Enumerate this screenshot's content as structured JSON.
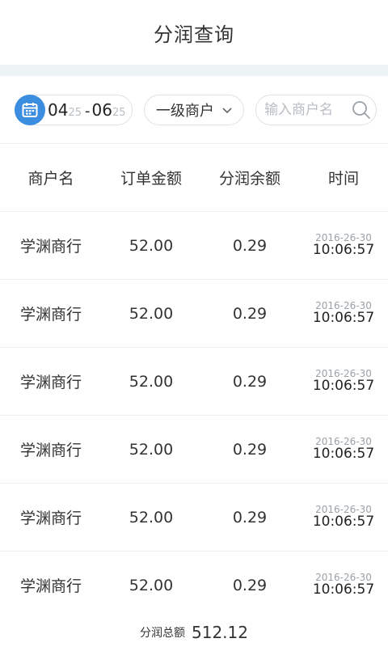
{
  "header": {
    "title": "分润查询"
  },
  "filters": {
    "date_range": {
      "start_month": "04",
      "start_day": "25",
      "separator": "-",
      "end_month": "06",
      "end_day": "25",
      "icon": "calendar-icon",
      "icon_color": "#3b8de0"
    },
    "merchant_level": {
      "selected": "一级商户",
      "icon": "chevron-down-icon"
    },
    "search": {
      "placeholder": "输入商户名",
      "value": "",
      "icon": "search-icon"
    }
  },
  "table": {
    "columns": [
      "商户名",
      "订单金额",
      "分润余额",
      "时间"
    ],
    "rows": [
      {
        "merchant": "学渊商行",
        "order_amount": "52.00",
        "profit_balance": "0.29",
        "date": "2016-26-30",
        "time": "10:06:57"
      },
      {
        "merchant": "学渊商行",
        "order_amount": "52.00",
        "profit_balance": "0.29",
        "date": "2016-26-30",
        "time": "10:06:57"
      },
      {
        "merchant": "学渊商行",
        "order_amount": "52.00",
        "profit_balance": "0.29",
        "date": "2016-26-30",
        "time": "10:06:57"
      },
      {
        "merchant": "学渊商行",
        "order_amount": "52.00",
        "profit_balance": "0.29",
        "date": "2016-26-30",
        "time": "10:06:57"
      },
      {
        "merchant": "学渊商行",
        "order_amount": "52.00",
        "profit_balance": "0.29",
        "date": "2016-26-30",
        "time": "10:06:57"
      },
      {
        "merchant": "学渊商行",
        "order_amount": "52.00",
        "profit_balance": "0.29",
        "date": "2016-26-30",
        "time": "10:06:57"
      }
    ]
  },
  "footer": {
    "total_label": "分润总额",
    "total_value": "512.12"
  }
}
